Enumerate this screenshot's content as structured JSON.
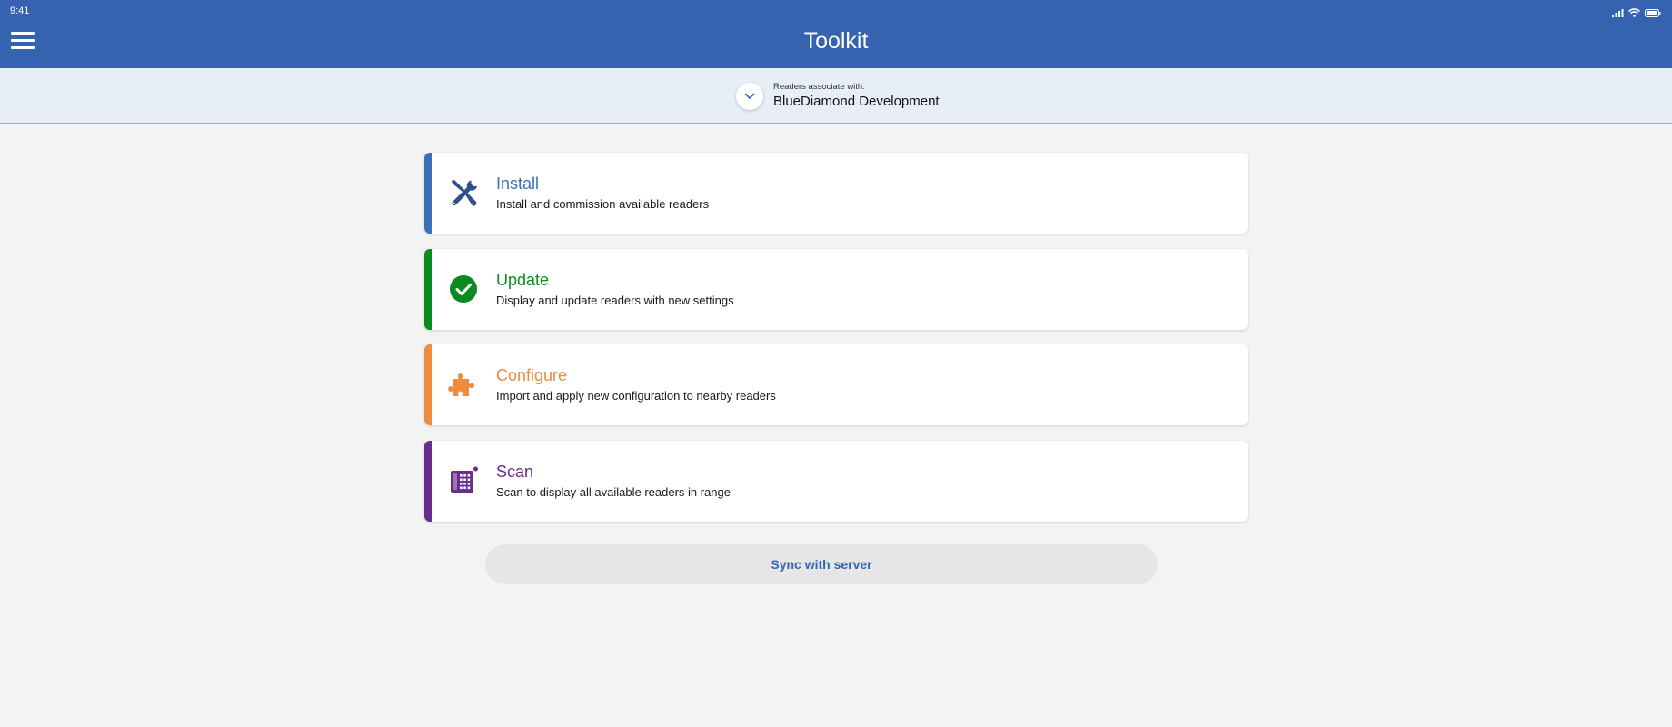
{
  "status_bar": {
    "time": "9:41",
    "icons": [
      "signal-icon",
      "wifi-icon",
      "battery-icon"
    ]
  },
  "header": {
    "title": "Toolkit",
    "menu_icon": "hamburger-menu-icon"
  },
  "association": {
    "label": "Readers associate with:",
    "value": "BlueDiamond Development",
    "icon": "chevron-down-icon"
  },
  "cards": [
    {
      "id": "install",
      "title": "Install",
      "description": "Install and commission available readers",
      "color": "#3a70b8",
      "icon": "tools-icon"
    },
    {
      "id": "update",
      "title": "Update",
      "description": "Display and update readers with new settings",
      "color": "#0a8a1f",
      "icon": "check-circle-icon"
    },
    {
      "id": "configure",
      "title": "Configure",
      "description": "Import and apply new configuration to nearby readers",
      "color": "#f08a3c",
      "icon": "puzzle-icon"
    },
    {
      "id": "scan",
      "title": "Scan",
      "description": "Scan to display all available readers in range",
      "color": "#6a2d8f",
      "icon": "reader-keypad-icon"
    }
  ],
  "sync_button": {
    "label": "Sync with server"
  },
  "colors": {
    "header_bg": "#3563b0",
    "subheader_bg": "#e7eef6",
    "page_bg": "#f3f3f3",
    "sync_text": "#3565b5"
  }
}
